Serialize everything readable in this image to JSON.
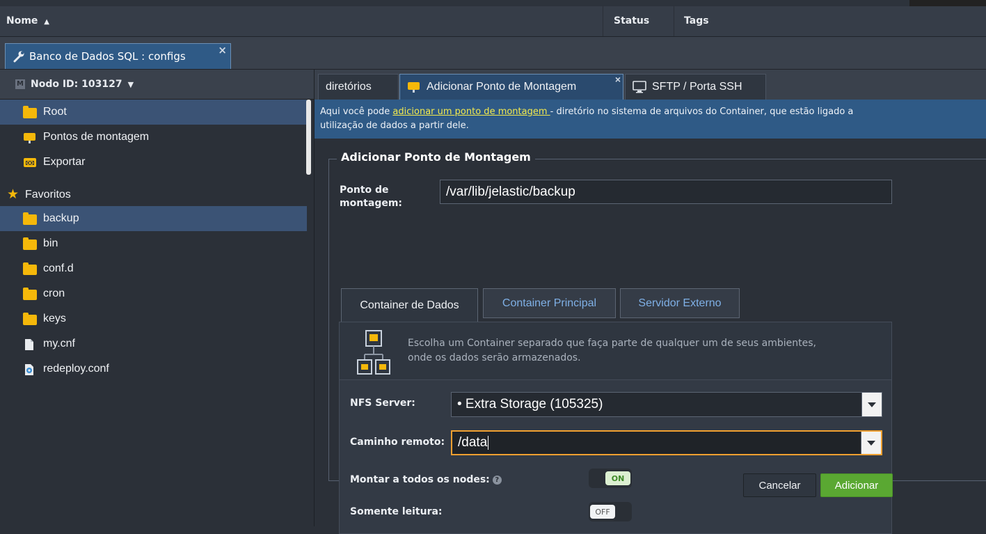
{
  "header": {
    "col_name": "Nome",
    "col_status": "Status",
    "col_tags": "Tags"
  },
  "window_tab": {
    "title": "Banco de Dados SQL : configs",
    "close": "×"
  },
  "sidebar": {
    "node_label": "Nodo ID: 103127",
    "node_badge": "M",
    "items": [
      {
        "label": "Root",
        "icon": "folder-icon"
      },
      {
        "label": "Pontos de montagem",
        "icon": "mount-folder-icon"
      },
      {
        "label": "Exportar",
        "icon": "export-icon"
      }
    ],
    "favorites_label": "Favoritos",
    "favorites": [
      {
        "label": "backup",
        "icon": "folder-icon"
      },
      {
        "label": "bin",
        "icon": "folder-icon"
      },
      {
        "label": "conf.d",
        "icon": "folder-icon"
      },
      {
        "label": "cron",
        "icon": "folder-icon"
      },
      {
        "label": "keys",
        "icon": "folder-icon"
      },
      {
        "label": "my.cnf",
        "icon": "file-icon"
      },
      {
        "label": "redeploy.conf",
        "icon": "config-file-icon"
      }
    ]
  },
  "panel_tabs": [
    {
      "label": "diretórios"
    },
    {
      "label": "Adicionar Ponto de Montagem",
      "close": "×"
    },
    {
      "label": "SFTP / Porta SSH"
    }
  ],
  "info": {
    "prefix": "Aqui você pode ",
    "link": "adicionar um ponto de montagem ",
    "suffix": "- diretório no sistema de arquivos do Container, que estão ligado a",
    "line2": "utilização de dados a partir dele."
  },
  "form": {
    "legend": "Adicionar Ponto de Montagem",
    "mount_point_label_1": "Ponto de",
    "mount_point_label_2": "montagem:",
    "mount_point_value": "/var/lib/jelastic/backup",
    "tabs": [
      "Container de Dados",
      "Container Principal",
      "Servidor Externo"
    ],
    "description_1": "Escolha um Container separado que faça parte de qualquer um de seus ambientes,",
    "description_2": "onde os dados serão armazenados.",
    "nfs_label": "NFS Server:",
    "nfs_value": "• Extra Storage (105325)",
    "remote_path_label": "Caminho remoto:",
    "remote_path_value": "/data",
    "mount_all_label": "Montar a todos os nodes:",
    "mount_all_state": "ON",
    "readonly_label": "Somente leitura:",
    "readonly_state": "OFF",
    "cancel_label": "Cancelar",
    "add_label": "Adicionar"
  },
  "colors": {
    "accent_blue": "#2f5a86",
    "selection": "#3b5375",
    "add_green": "#5aa832",
    "focus_orange": "#f0a030",
    "link_yellow": "#f3ea4e"
  }
}
